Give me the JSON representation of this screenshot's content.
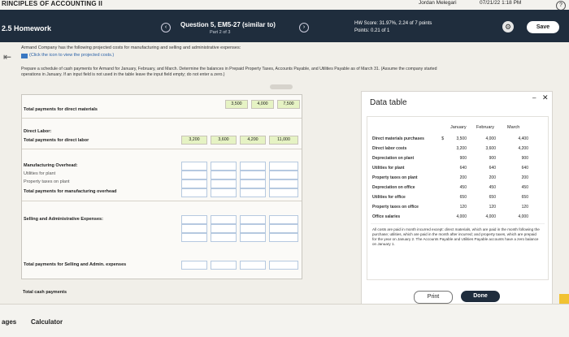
{
  "topbar": {
    "course": "RINCIPLES OF ACCOUNTING II",
    "student": "Jordan Melegari",
    "datetime": "07/21/22 1:18 PM",
    "help": "?"
  },
  "header": {
    "hw_title": "2.5 Homework",
    "question_title": "Question 5, EM5-27 (similar to)",
    "question_part": "Part 2 of 3",
    "hw_score": "HW Score: 31.97%, 2.24 of 7 points",
    "points": "Points: 0.21 of 1",
    "save_label": "Save",
    "prev_icon": "‹",
    "next_icon": "›",
    "gear_icon": "⚙"
  },
  "instructions": {
    "description": "Armand Company has the following projected costs for manufacturing and selling and administrative expenses:",
    "click_text": "(Click the icon to view the projected costs.)",
    "prepare_line1": "Prepare a schedule of cash payments for Armand for January, February, and March. Determine the balances in Prepaid Property Taxes, Accounts Payable, and Utilities Payable as of March 31. (Assume the company started",
    "prepare_line2": "operations in January. If an input field is not used in the table leave the input field empty; do not enter a zero.)",
    "back_icon": "⇤"
  },
  "schedule": {
    "rows": {
      "direct_materials": "Total payments for direct materials",
      "direct_labor": "Direct Labor:",
      "total_direct_labor": "Total payments for direct labor",
      "mfg_overhead": "Manufacturing Overhead:",
      "utilities_plant": "Utilities for plant",
      "property_taxes_plant": "Property taxes on plant",
      "total_mfg": "Total payments for manufacturing overhead",
      "sga": "Selling and Administrative Expenses:",
      "total_sga": "Total payments for Selling and Admin. expenses",
      "total_cash": "Total cash payments"
    },
    "dm_values": [
      "3,500",
      "4,000",
      "7,500"
    ],
    "dollar": "$",
    "dl_values": [
      "3,200",
      "3,600",
      "4,200",
      "11,000"
    ]
  },
  "data_table": {
    "title": "Data table",
    "minimize": "–",
    "close": "✕",
    "columns": [
      "January",
      "February",
      "March"
    ],
    "rows": [
      {
        "label": "Direct materials purchases",
        "jan": "3,500",
        "feb": "4,000",
        "mar": "4,400",
        "dollar": "$"
      },
      {
        "label": "Direct labor costs",
        "jan": "3,200",
        "feb": "3,600",
        "mar": "4,200"
      },
      {
        "label": "Depreciation on plant",
        "jan": "900",
        "feb": "900",
        "mar": "900"
      },
      {
        "label": "Utilities for plant",
        "jan": "640",
        "feb": "640",
        "mar": "640"
      },
      {
        "label": "Property taxes on plant",
        "jan": "200",
        "feb": "200",
        "mar": "200"
      },
      {
        "label": "Depreciation on office",
        "jan": "450",
        "feb": "450",
        "mar": "450"
      },
      {
        "label": "Utilities for office",
        "jan": "650",
        "feb": "650",
        "mar": "650"
      },
      {
        "label": "Property taxes on office",
        "jan": "120",
        "feb": "120",
        "mar": "120"
      },
      {
        "label": "Office salaries",
        "jan": "4,000",
        "feb": "4,000",
        "mar": "4,000"
      }
    ],
    "note": "All costs are paid in month incurred except: direct materials, which are paid in the month following the purchase; utilities, which are paid in the month after incurred; and property taxes, which are prepaid for the year on January 2. The Accounts Payable and Utilities Payable accounts have a zero balance on January 1.",
    "print_label": "Print",
    "done_label": "Done"
  },
  "bottom": {
    "pages": "ages",
    "calculator": "Calculator"
  },
  "colors": {
    "header_bg": "#1f2d3d",
    "cell_green": "#e6f3c4",
    "done_bg": "#1f2d3d"
  }
}
